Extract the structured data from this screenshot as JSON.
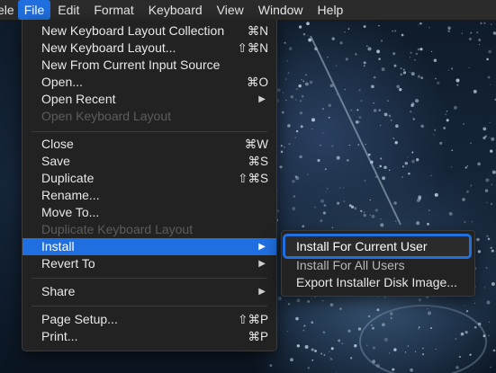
{
  "menubar": {
    "app_fragment": "ele",
    "items": [
      "File",
      "Edit",
      "Format",
      "Keyboard",
      "View",
      "Window",
      "Help"
    ],
    "active": "File"
  },
  "file_menu": {
    "items": [
      {
        "label": "New Keyboard Layout Collection",
        "shortcut": "⌘N"
      },
      {
        "label": "New Keyboard Layout...",
        "shortcut": "⇧⌘N"
      },
      {
        "label": "New From Current Input Source",
        "shortcut": ""
      },
      {
        "label": "Open...",
        "shortcut": "⌘O"
      },
      {
        "label": "Open Recent",
        "submenu": true
      },
      {
        "label": "Open Keyboard Layout",
        "disabled": true
      },
      {
        "label": "Close",
        "shortcut": "⌘W"
      },
      {
        "label": "Save",
        "shortcut": "⌘S"
      },
      {
        "label": "Duplicate",
        "shortcut": "⇧⌘S"
      },
      {
        "label": "Rename..."
      },
      {
        "label": "Move To..."
      },
      {
        "label": "Duplicate Keyboard Layout",
        "disabled": true
      },
      {
        "label": "Install",
        "submenu": true,
        "highlighted": true
      },
      {
        "label": "Revert To",
        "submenu": true
      },
      {
        "label": "Share",
        "submenu": true
      },
      {
        "label": "Page Setup...",
        "shortcut": "⇧⌘P"
      },
      {
        "label": "Print...",
        "shortcut": "⌘P"
      }
    ]
  },
  "install_submenu": {
    "items": [
      {
        "label": "Install For Current User",
        "highlighted": true
      },
      {
        "label": "Install For All Users"
      },
      {
        "label": "Export Installer Disk Image..."
      }
    ]
  },
  "colors": {
    "menu_bg": "#222222",
    "highlight": "#1f6fe0",
    "text": "#e8e8e8",
    "disabled_text": "#5c5c5c"
  }
}
